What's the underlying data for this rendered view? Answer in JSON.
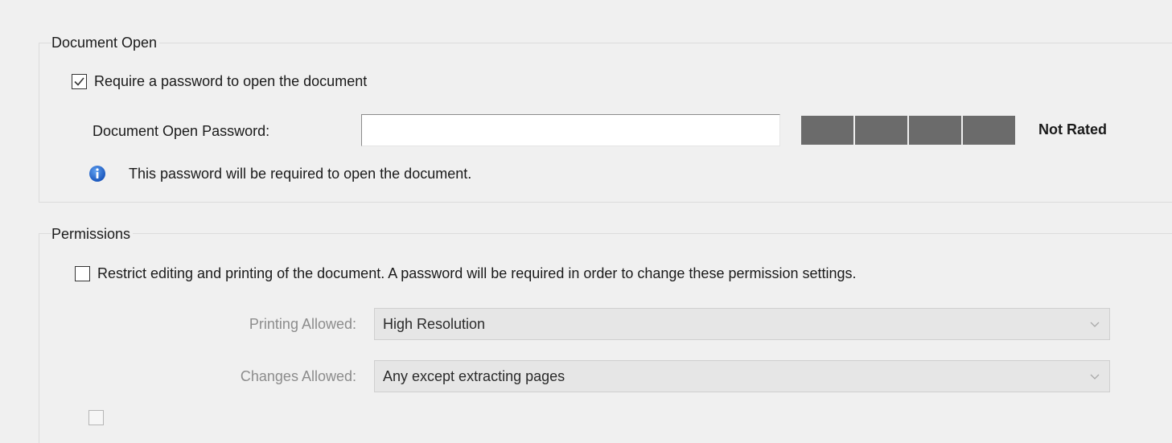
{
  "document_open": {
    "legend": "Document Open",
    "require_password": {
      "label": "Require a password to open the document",
      "checked": true
    },
    "password_field": {
      "label": "Document Open Password:",
      "value": ""
    },
    "strength_meter": {
      "rating": "Not Rated"
    },
    "info": {
      "icon": "info-icon",
      "text": "This password will be required to open the document."
    }
  },
  "permissions": {
    "legend": "Permissions",
    "restrict": {
      "label": "Restrict editing and printing of the document. A password will be required in order to change these permission settings.",
      "checked": false
    },
    "printing": {
      "label": "Printing Allowed:",
      "value": "High Resolution"
    },
    "changes": {
      "label": "Changes Allowed:",
      "value": "Any except extracting pages"
    }
  },
  "colors": {
    "background": "#f0f0f0",
    "meter_segment": "#6b6b6b",
    "info_blue": "#1a63c9",
    "disabled_text": "#8c8c8c"
  }
}
